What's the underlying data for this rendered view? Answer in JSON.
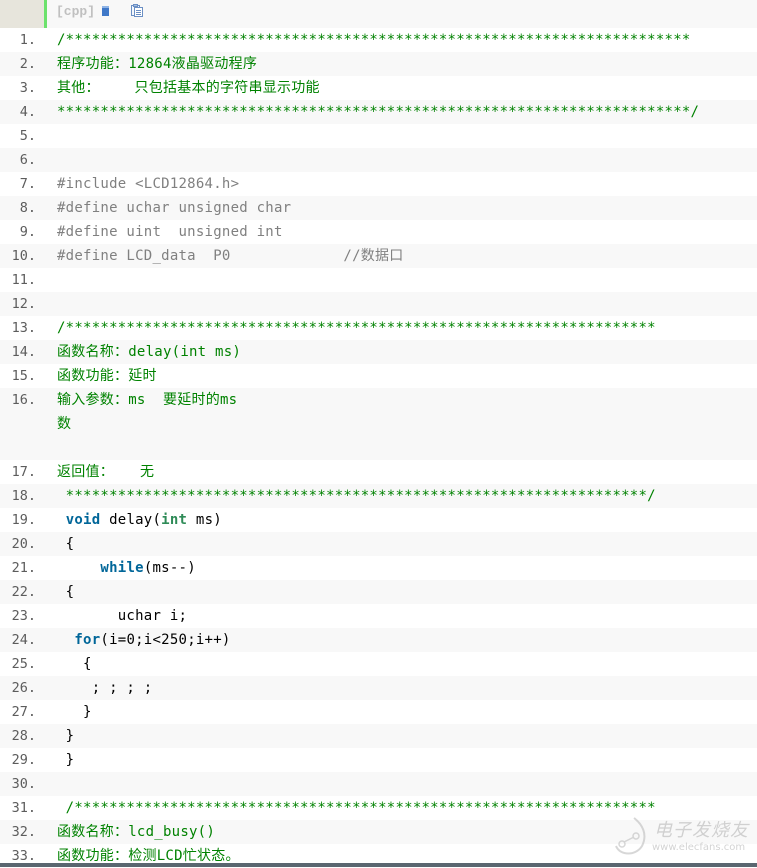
{
  "header": {
    "language": "[cpp]",
    "view_source_icon": "view-source-icon",
    "copy_icon": "copy-icon"
  },
  "lines": [
    {
      "n": "1.",
      "text": "/************************************************************************",
      "cls": "cmt"
    },
    {
      "n": "2.",
      "text": "程序功能：12864液晶驱动程序",
      "cls": "cmt"
    },
    {
      "n": "3.",
      "text": "其他：    只包括基本的字符串显示功能",
      "cls": "cmt"
    },
    {
      "n": "4.",
      "text": "*************************************************************************/",
      "cls": "cmt"
    },
    {
      "n": "5.",
      "text": "",
      "cls": "plain"
    },
    {
      "n": "6.",
      "text": "",
      "cls": "plain"
    },
    {
      "n": "7.",
      "text": "#include <LCD12864.h>",
      "cls": "pp"
    },
    {
      "n": "8.",
      "text": "#define uchar unsigned char",
      "cls": "pp"
    },
    {
      "n": "9.",
      "text": "#define uint  unsigned int",
      "cls": "pp"
    },
    {
      "n": "10.",
      "text": "#define LCD_data  P0             //数据口",
      "cls": "pp"
    },
    {
      "n": "11.",
      "text": "",
      "cls": "plain"
    },
    {
      "n": "12.",
      "text": "",
      "cls": "plain"
    },
    {
      "n": "13.",
      "text": "/********************************************************************",
      "cls": "cmt"
    },
    {
      "n": "14.",
      "text": "函数名称：delay(int ms)",
      "cls": "cmt"
    },
    {
      "n": "15.",
      "text": "函数功能：延时",
      "cls": "cmt"
    },
    {
      "n": "16.",
      "text": "输入参数：ms  要延时的ms",
      "cls": "cmt",
      "wrap": "数"
    },
    {
      "n": "17.",
      "text": "返回值：   无",
      "cls": "cmt"
    },
    {
      "n": "18.",
      "text": " *******************************************************************/",
      "cls": "cmt"
    },
    {
      "n": "19.",
      "text": " void delay(int ms)",
      "cls": "code"
    },
    {
      "n": "20.",
      "text": " {",
      "cls": "plain"
    },
    {
      "n": "21.",
      "text": "     while(ms--)",
      "cls": "code"
    },
    {
      "n": "22.",
      "text": " {",
      "cls": "plain"
    },
    {
      "n": "23.",
      "text": "       uchar i;",
      "cls": "plain"
    },
    {
      "n": "24.",
      "text": "  for(i=0;i<250;i++)",
      "cls": "code"
    },
    {
      "n": "25.",
      "text": "   {",
      "cls": "plain"
    },
    {
      "n": "26.",
      "text": "    ; ; ; ;",
      "cls": "plain"
    },
    {
      "n": "27.",
      "text": "   }",
      "cls": "plain"
    },
    {
      "n": "28.",
      "text": " }",
      "cls": "plain"
    },
    {
      "n": "29.",
      "text": " }",
      "cls": "plain"
    },
    {
      "n": "30.",
      "text": "",
      "cls": "plain"
    },
    {
      "n": "31.",
      "text": " /*******************************************************************",
      "cls": "cmt"
    },
    {
      "n": "32.",
      "text": "函数名称：lcd_busy()",
      "cls": "cmt"
    },
    {
      "n": "33.",
      "text": "函数功能：检测LCD忙状态。",
      "cls": "cmt"
    }
  ],
  "code_tokens": {
    "19": [
      {
        "t": " ",
        "c": "plain"
      },
      {
        "t": "void",
        "c": "kw"
      },
      {
        "t": " delay(",
        "c": "plain"
      },
      {
        "t": "int",
        "c": "kw-type"
      },
      {
        "t": " ms)",
        "c": "plain"
      }
    ],
    "21": [
      {
        "t": "     ",
        "c": "plain"
      },
      {
        "t": "while",
        "c": "kw"
      },
      {
        "t": "(ms--)",
        "c": "plain"
      }
    ],
    "24": [
      {
        "t": "  ",
        "c": "plain"
      },
      {
        "t": "for",
        "c": "kw"
      },
      {
        "t": "(i=0;i<250;i++)",
        "c": "plain"
      }
    ]
  },
  "watermark": {
    "brand": "电子发烧友",
    "url": "www.elecfans.com"
  }
}
